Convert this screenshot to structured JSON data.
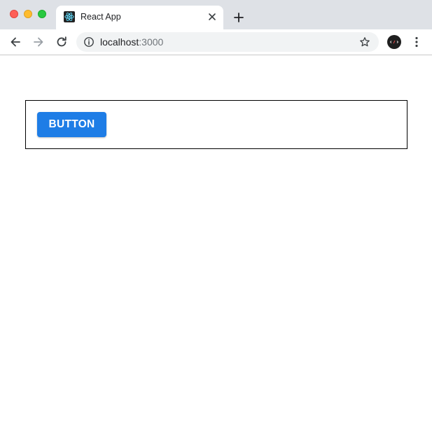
{
  "browser": {
    "tab": {
      "title": "React App",
      "favicon": "react-logo-icon",
      "close_icon": "close-icon"
    },
    "new_tab_icon": "plus-icon",
    "toolbar": {
      "back_icon": "arrow-left-icon",
      "forward_icon": "arrow-right-icon",
      "reload_icon": "reload-icon",
      "info_icon": "info-icon",
      "url_host": "localhost",
      "url_port": ":3000",
      "star_icon": "star-outline-icon",
      "extension_icon": "extension-avatar-icon",
      "menu_icon": "kebab-menu-icon"
    }
  },
  "page": {
    "button_label": "BUTTON"
  },
  "colors": {
    "button_bg": "#1e7de6",
    "button_text": "#ffffff",
    "tabstrip_bg": "#dee1e6",
    "omnibox_bg": "#f1f3f4",
    "traffic_close": "#fe5f57",
    "traffic_minimize": "#febc2e",
    "traffic_maximize": "#28c840",
    "box_border": "#000000"
  }
}
